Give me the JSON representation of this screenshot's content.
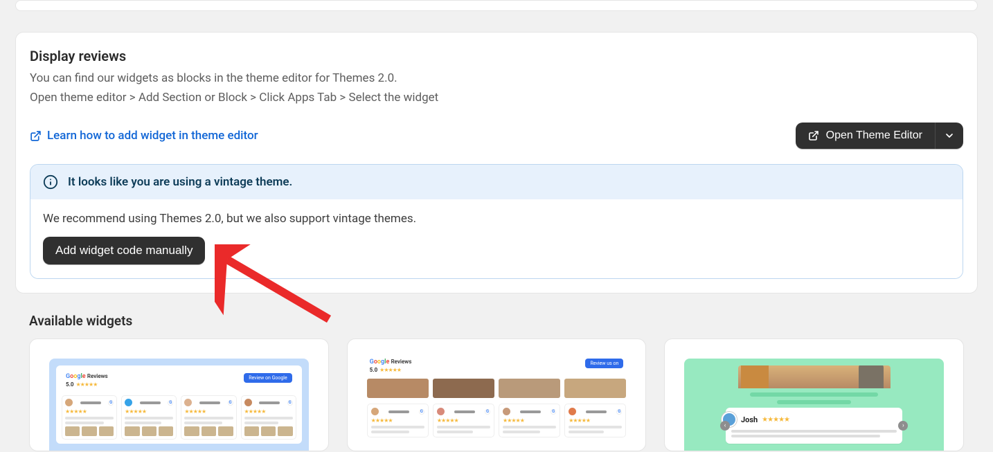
{
  "section": {
    "title": "Display reviews",
    "line1": "You can find our widgets as blocks in the theme editor for Themes 2.0.",
    "line2": "Open theme editor > Add Section or Block > Click Apps Tab > Select the widget",
    "learn_link": "Learn how to add widget in theme editor",
    "open_editor": "Open Theme Editor"
  },
  "alert": {
    "title": "It looks like you are using a vintage theme.",
    "body": "We recommend using Themes 2.0, but we also support vintage themes.",
    "button": "Add widget code manually"
  },
  "available": {
    "title": "Available widgets"
  },
  "preview": {
    "google": "Google",
    "reviews_word": "Reviews",
    "score": "5.0",
    "stars": "★★★★★",
    "josh": "Josh"
  }
}
